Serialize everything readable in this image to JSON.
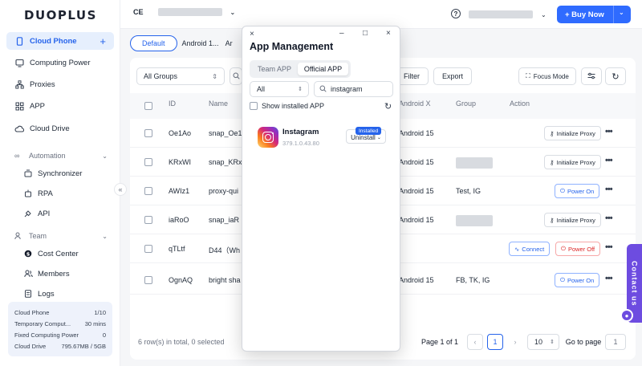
{
  "app": {
    "logo": "DUOPLUS"
  },
  "sidebar": {
    "items": [
      {
        "label": "Cloud Phone",
        "icon": "phone-icon"
      },
      {
        "label": "Computing Power",
        "icon": "monitor-icon"
      },
      {
        "label": "Proxies",
        "icon": "network-icon"
      },
      {
        "label": "APP",
        "icon": "grid-icon"
      },
      {
        "label": "Cloud Drive",
        "icon": "cloud-icon"
      }
    ],
    "automation": {
      "label": "Automation",
      "items": [
        {
          "label": "Synchronizer"
        },
        {
          "label": "RPA"
        },
        {
          "label": "API"
        }
      ]
    },
    "team": {
      "label": "Team",
      "items": [
        {
          "label": "Cost Center"
        },
        {
          "label": "Members"
        },
        {
          "label": "Logs"
        }
      ]
    },
    "usage": [
      {
        "label": "Cloud Phone",
        "value": "1/10"
      },
      {
        "label": "Temporary Comput...",
        "value": "30 mins"
      },
      {
        "label": "Fixed Computing Power",
        "value": "0"
      },
      {
        "label": "Cloud Drive",
        "value": "795.67MB / 5GB"
      }
    ]
  },
  "topbar": {
    "workspace_initials": "CE",
    "help": "?",
    "buy_now": "+ Buy Now"
  },
  "tabs": [
    {
      "label": "Default"
    },
    {
      "label": "Android 1..."
    },
    {
      "label": "Ar"
    }
  ],
  "toolbar": {
    "group_select": "All Groups",
    "filter": "Filter",
    "export": "Export",
    "focus_mode": "Focus Mode"
  },
  "table": {
    "columns": {
      "id": "ID",
      "name": "Name",
      "os": "Android X",
      "group": "Group",
      "action": "Action"
    },
    "rows": [
      {
        "id": "Oe1Ao",
        "name": "snap_Oe1",
        "os": "Android 15",
        "group": "",
        "actions": [
          "Initialize Proxy"
        ]
      },
      {
        "id": "KRxWI",
        "name": "snap_KRx",
        "os": "Android 15",
        "group": "",
        "actions": [
          "Initialize Proxy"
        ]
      },
      {
        "id": "AWIz1",
        "name": "proxy-qui",
        "os": "Android 15",
        "group": "Test, IG",
        "actions": [
          "Power On"
        ]
      },
      {
        "id": "iaRoO",
        "name": "snap_iaR",
        "os": "Android 15",
        "group": "",
        "actions": [
          "Initialize Proxy"
        ]
      },
      {
        "id": "qTLtf",
        "name": "D44（Wh",
        "os": "",
        "group": "",
        "actions": [
          "Connect",
          "Power Off"
        ]
      },
      {
        "id": "OgnAQ",
        "name": "bright sha",
        "os": "Android 15",
        "group": "FB, TK, IG",
        "actions": [
          "Power On"
        ]
      }
    ]
  },
  "footer": {
    "summary": "6 row(s) in total, 0 selected",
    "page_of": "Page 1 of 1",
    "current_page": "1",
    "page_size": "10",
    "go_to": "Go to page",
    "go_value": "1"
  },
  "contact": {
    "label": "Contact us"
  },
  "modal": {
    "title": "App Management",
    "tabs": [
      {
        "label": "Team APP",
        "active": false
      },
      {
        "label": "Official APP",
        "active": true
      }
    ],
    "filter_select": "All",
    "search_value": "instagram",
    "show_installed": "Show installed APP",
    "apps": [
      {
        "name": "Instagram",
        "version": "379.1.0.43.80",
        "badge": "Installed",
        "action": "Uninstall"
      }
    ]
  },
  "colors": {
    "accent": "#2f6bff",
    "active_bg": "#e6effd",
    "danger": "#dc2626",
    "contact": "#6d4ce0"
  }
}
